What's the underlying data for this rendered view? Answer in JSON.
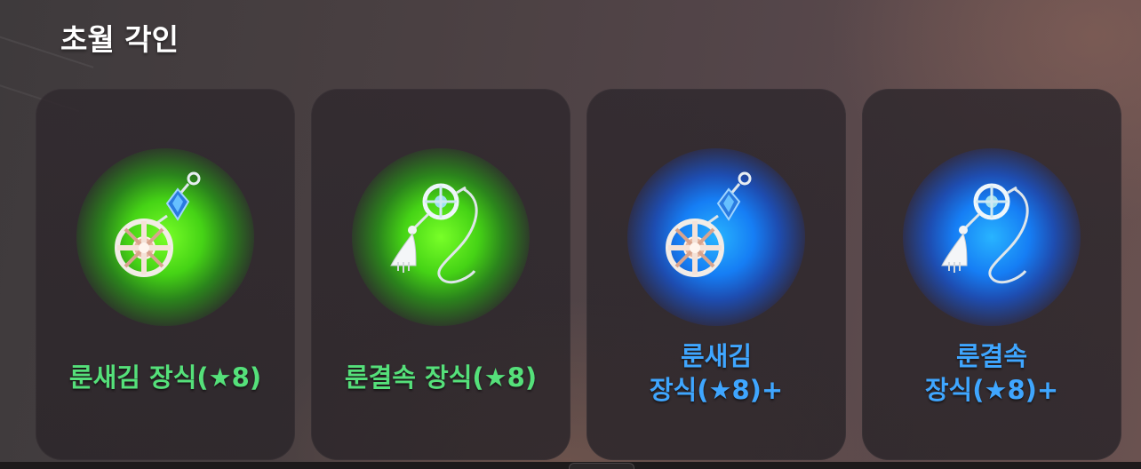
{
  "title": "초월 각인",
  "colors": {
    "green_glow": "#4cdc1e",
    "blue_glow": "#1e82ff",
    "green_text": "#55e07a",
    "blue_text": "#3fa6ff"
  },
  "items": [
    {
      "name_line1": "룬새김 장식(★8)",
      "name_line2": "",
      "grade": "green",
      "icon": "rune-engrave-ornament-icon"
    },
    {
      "name_line1": "룬결속 장식(★8)",
      "name_line2": "",
      "grade": "green",
      "icon": "rune-bind-ornament-icon"
    },
    {
      "name_line1": "룬새김",
      "name_line2": "장식(★8)+",
      "grade": "blue",
      "icon": "rune-engrave-ornament-icon"
    },
    {
      "name_line1": "룬결속",
      "name_line2": "장식(★8)+",
      "grade": "blue",
      "icon": "rune-bind-ornament-icon"
    }
  ]
}
